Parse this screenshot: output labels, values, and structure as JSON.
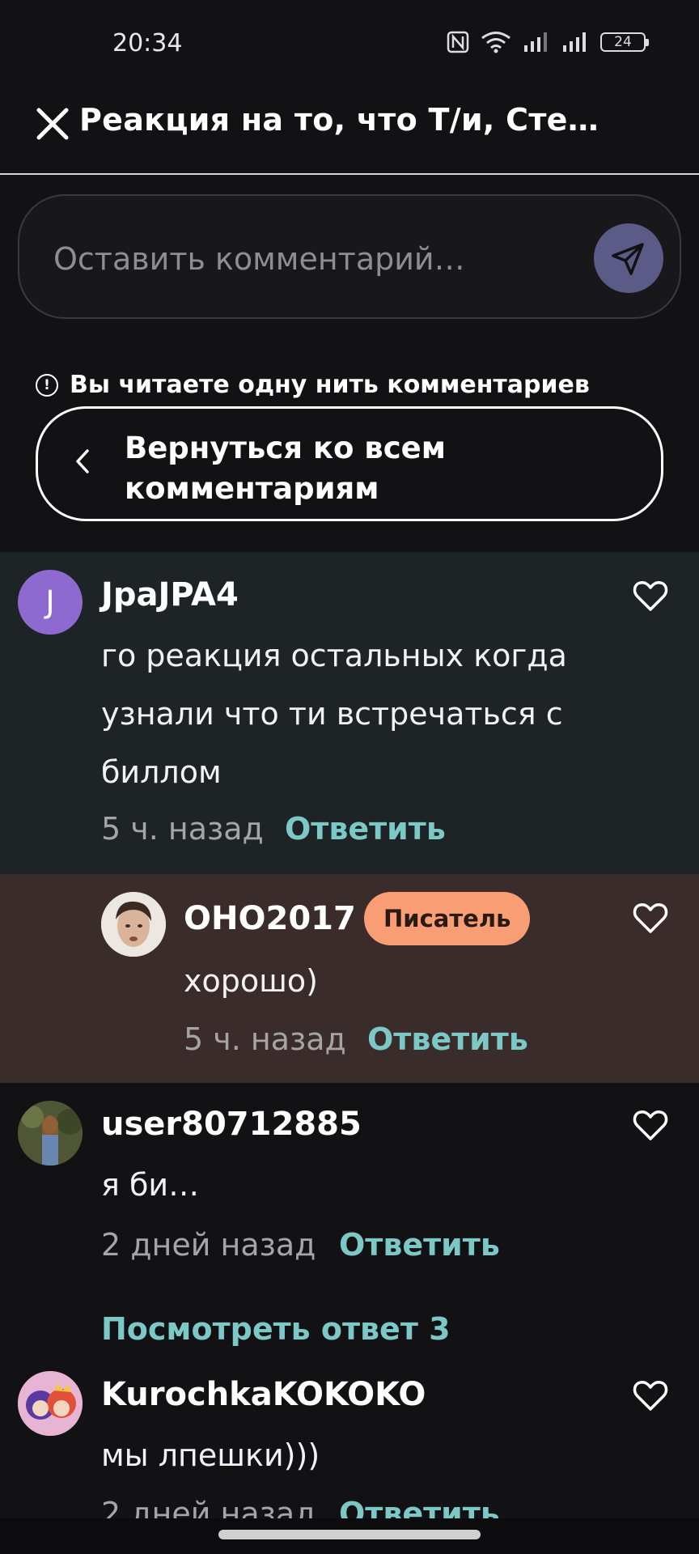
{
  "status_bar": {
    "time": "20:34",
    "battery": "24"
  },
  "header": {
    "title": "Реакция на то, что Т/и, Сте…"
  },
  "comment_input": {
    "placeholder": "Оставить комментарий…"
  },
  "thread_notice": {
    "text": "Вы читаете одну нить комментариев",
    "icon": "!"
  },
  "back_button": {
    "label": "Вернуться ко всем комментариям"
  },
  "comments": [
    {
      "avatar_letter": "J",
      "username": "JpaJPA4",
      "text": "го реакция остальных когда узнали что ти встречаться с биллом",
      "time": "5 ч. назад",
      "reply_label": "Ответить"
    },
    {
      "username": "OHO2017",
      "badge": "Писатель",
      "text": "хорошо)",
      "time": "5 ч. назад",
      "reply_label": "Ответить"
    },
    {
      "username": "user80712885",
      "text": "я би…",
      "time": "2 дней назад",
      "reply_label": "Ответить"
    },
    {
      "username": "KurochkaKOKOKO",
      "text": "мы лпешки)))",
      "time": "2 дней назад",
      "reply_label": "Ответить"
    }
  ],
  "view_replies": {
    "label": "Посмотреть ответ 3"
  },
  "colors": {
    "background": "#121214",
    "highlight_comment_bg": "#1e2426",
    "author_reply_bg": "#3a2c2a",
    "accent_teal": "#7cc8c6",
    "badge_orange": "#f99e74",
    "send_button": "#5c5a86",
    "avatar_purple": "#8e6ad0"
  }
}
